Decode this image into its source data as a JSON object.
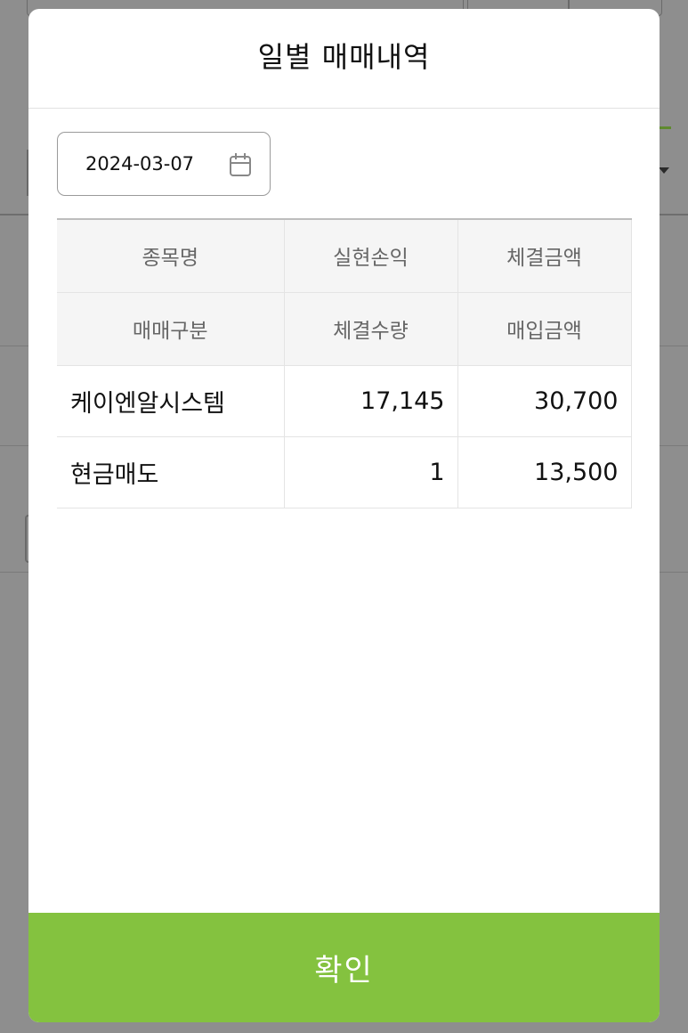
{
  "modal": {
    "title": "일별 매매내역",
    "date_value": "2024-03-07",
    "confirm_label": "확인"
  },
  "table": {
    "header_row_1": [
      "종목명",
      "실현손익",
      "체결금액"
    ],
    "header_row_2": [
      "매매구분",
      "체결수량",
      "매입금액"
    ],
    "rows": [
      {
        "name": "케이엔알시스템",
        "realized_pnl": "17,145",
        "trade_amount": "30,700",
        "trade_type": "현금매도",
        "quantity": "1",
        "purchase_amount": "13,500"
      }
    ]
  },
  "colors": {
    "accent": "#84c23f",
    "profit": "#d6403a"
  },
  "icons": {
    "date": "calendar-icon"
  }
}
